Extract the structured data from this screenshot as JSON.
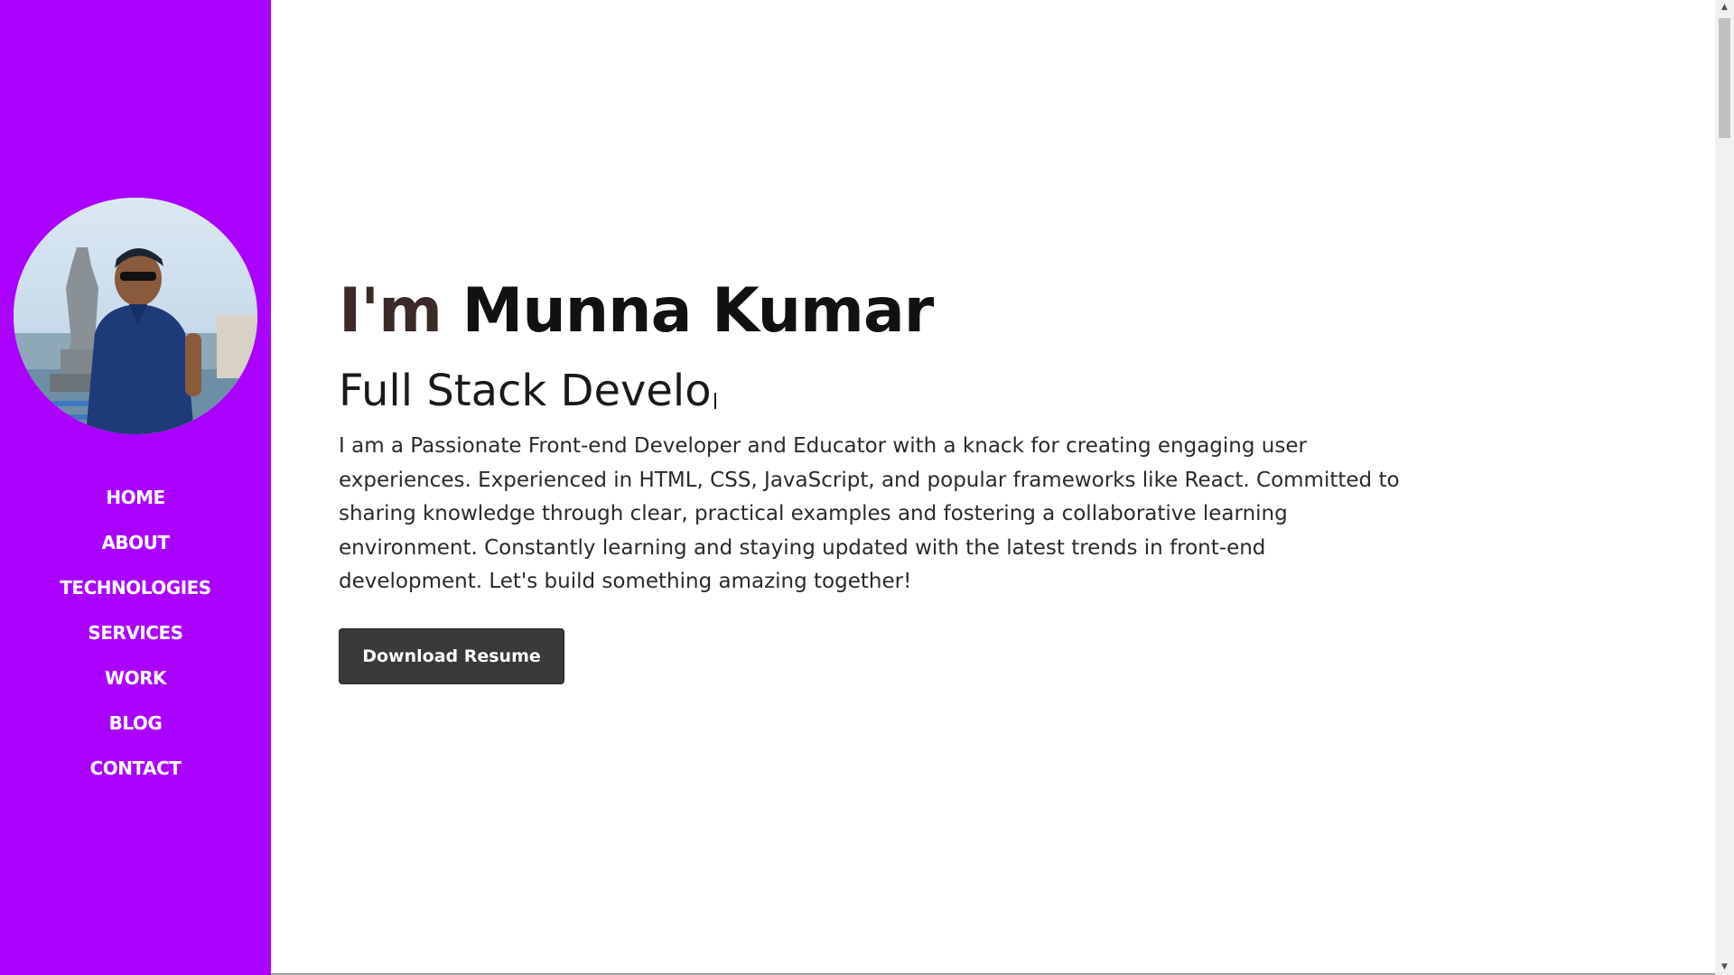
{
  "sidebar": {
    "background_color": "#aa00ff",
    "avatar_icon": "profile-photo",
    "nav_items": [
      {
        "label": "HOME"
      },
      {
        "label": "ABOUT"
      },
      {
        "label": "TECHNOLOGIES"
      },
      {
        "label": "SERVICES"
      },
      {
        "label": "WORK"
      },
      {
        "label": "BLOG"
      },
      {
        "label": "CONTACT"
      }
    ]
  },
  "hero": {
    "greeting_prefix": "I'm",
    "name": "Munna Kumar",
    "typed_role": "Full Stack Develo",
    "bio": "I am a Passionate Front-end Developer and Educator with a knack for creating engaging user experiences. Experienced in HTML, CSS, JavaScript, and popular frameworks like React. Committed to sharing knowledge through clear, practical examples and fostering a collaborative learning environment. Constantly learning and staying updated with the latest trends in front-end development. Let's build something amazing together!",
    "download_button_label": "Download Resume",
    "button_color": "#3a3a3a"
  },
  "scrollbar": {
    "up_icon": "triangle-up-icon",
    "down_icon": "triangle-down-icon"
  }
}
